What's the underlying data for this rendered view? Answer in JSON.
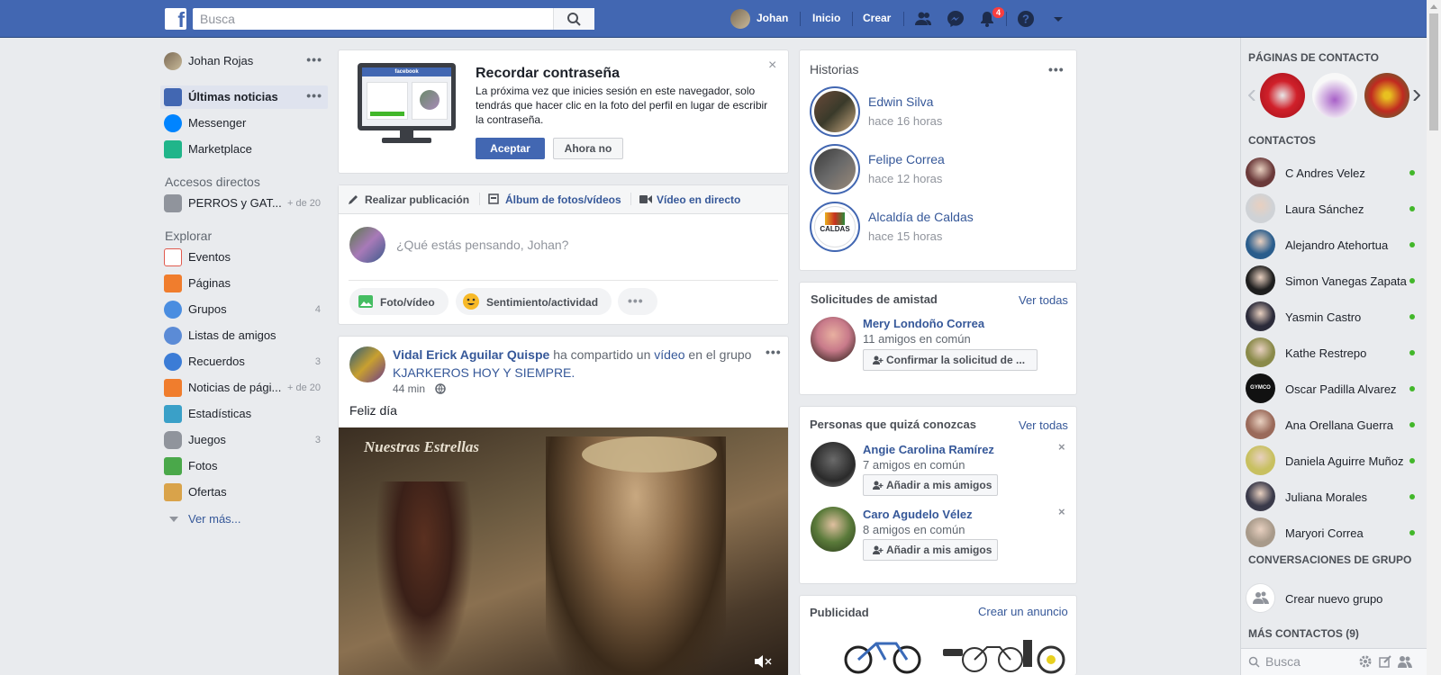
{
  "topbar": {
    "search_placeholder": "Busca",
    "user_name": "Johan",
    "nav_home": "Inicio",
    "nav_create": "Crear",
    "notifications_count": "4"
  },
  "left_nav": {
    "profile_name": "Johan Rojas",
    "items": [
      {
        "label": "Últimas noticias"
      },
      {
        "label": "Messenger"
      },
      {
        "label": "Marketplace"
      }
    ],
    "shortcuts_title": "Accesos directos",
    "shortcuts": [
      {
        "label": "PERROS y GAT...",
        "count": "+ de 20"
      }
    ],
    "explore_title": "Explorar",
    "explore": [
      {
        "label": "Eventos",
        "count": ""
      },
      {
        "label": "Páginas",
        "count": ""
      },
      {
        "label": "Grupos",
        "count": "4"
      },
      {
        "label": "Listas de amigos",
        "count": ""
      },
      {
        "label": "Recuerdos",
        "count": "3"
      },
      {
        "label": "Noticias de pági...",
        "count": "+ de 20"
      },
      {
        "label": "Estadísticas",
        "count": ""
      },
      {
        "label": "Juegos",
        "count": "3"
      },
      {
        "label": "Fotos",
        "count": ""
      },
      {
        "label": "Ofertas",
        "count": ""
      }
    ],
    "see_more": "Ver más..."
  },
  "password_card": {
    "title": "Recordar contraseña",
    "body": "La próxima vez que inicies sesión en este navegador, solo tendrás que hacer clic en la foto del perfil en lugar de escribir la contraseña.",
    "accept": "Aceptar",
    "decline": "Ahora no",
    "brand": "facebook"
  },
  "composer": {
    "tabs": [
      "Realizar publicación",
      "Álbum de fotos/vídeos",
      "Vídeo en directo"
    ],
    "placeholder": "¿Qué estás pensando, Johan?",
    "actions": [
      "Foto/vídeo",
      "Sentimiento/actividad"
    ]
  },
  "post": {
    "author": "Vidal Erick Aguilar Quispe",
    "action_pre": "ha compartido un ",
    "action_link": "vídeo",
    "action_post": " en el grupo",
    "group": "KJARKEROS HOY Y SIEMPRE.",
    "time": "44 min",
    "text": "Feliz día",
    "video_caption": "Nuestras Estrellas"
  },
  "stories": {
    "title": "Historias",
    "items": [
      {
        "name": "Edwin Silva",
        "time": "hace 16 horas"
      },
      {
        "name": "Felipe Correa",
        "time": "hace 12 horas"
      },
      {
        "name": "Alcaldía de Caldas",
        "time": "hace 15 horas"
      }
    ],
    "caldas_logo": "CALDAS"
  },
  "friend_requests": {
    "title": "Solicitudes de amistad",
    "see_all": "Ver todas",
    "name": "Mery Londoño Correa",
    "mutual": "11 amigos en común",
    "confirm": "Confirmar la solicitud de ..."
  },
  "pymk": {
    "title": "Personas que quizá conozcas",
    "see_all": "Ver todas",
    "people": [
      {
        "name": "Angie Carolina Ramírez",
        "mutual": "7 amigos en común",
        "button": "Añadir a mis amigos"
      },
      {
        "name": "Caro Agudelo Vélez",
        "mutual": "8 amigos en común",
        "button": "Añadir a mis amigos"
      }
    ]
  },
  "ads": {
    "title": "Publicidad",
    "create": "Crear un anuncio"
  },
  "sidebar": {
    "pages_title": "PÁGINAS DE CONTACTO",
    "contacts_title": "CONTACTOS",
    "contacts": [
      {
        "name": "C Andres Velez",
        "color": "#6b3a3a"
      },
      {
        "name": "Laura Sánchez",
        "color": "#cfd2d6"
      },
      {
        "name": "Alejandro Atehortua",
        "color": "#2a5d8c"
      },
      {
        "name": "Simon Vanegas Zapata",
        "color": "#1e1e1e"
      },
      {
        "name": "Yasmin Castro",
        "color": "#2b2b3a"
      },
      {
        "name": "Kathe Restrepo",
        "color": "#8a8a4a"
      },
      {
        "name": "Oscar Padilla Alvarez",
        "color": "#111111"
      },
      {
        "name": "Ana Orellana Guerra",
        "color": "#9a6a5a"
      },
      {
        "name": "Daniela Aguirre Muñoz",
        "color": "#c8c060"
      },
      {
        "name": "Juliana Morales",
        "color": "#3a3a4a"
      },
      {
        "name": "Maryori Correa",
        "color": "#a89a8a"
      }
    ],
    "groups_title": "CONVERSACIONES DE GRUPO",
    "new_group": "Crear nuevo grupo",
    "more_contacts": "MÁS CONTACTOS (9)",
    "search_placeholder": "Busca",
    "gymco_label": "GYMCO"
  }
}
